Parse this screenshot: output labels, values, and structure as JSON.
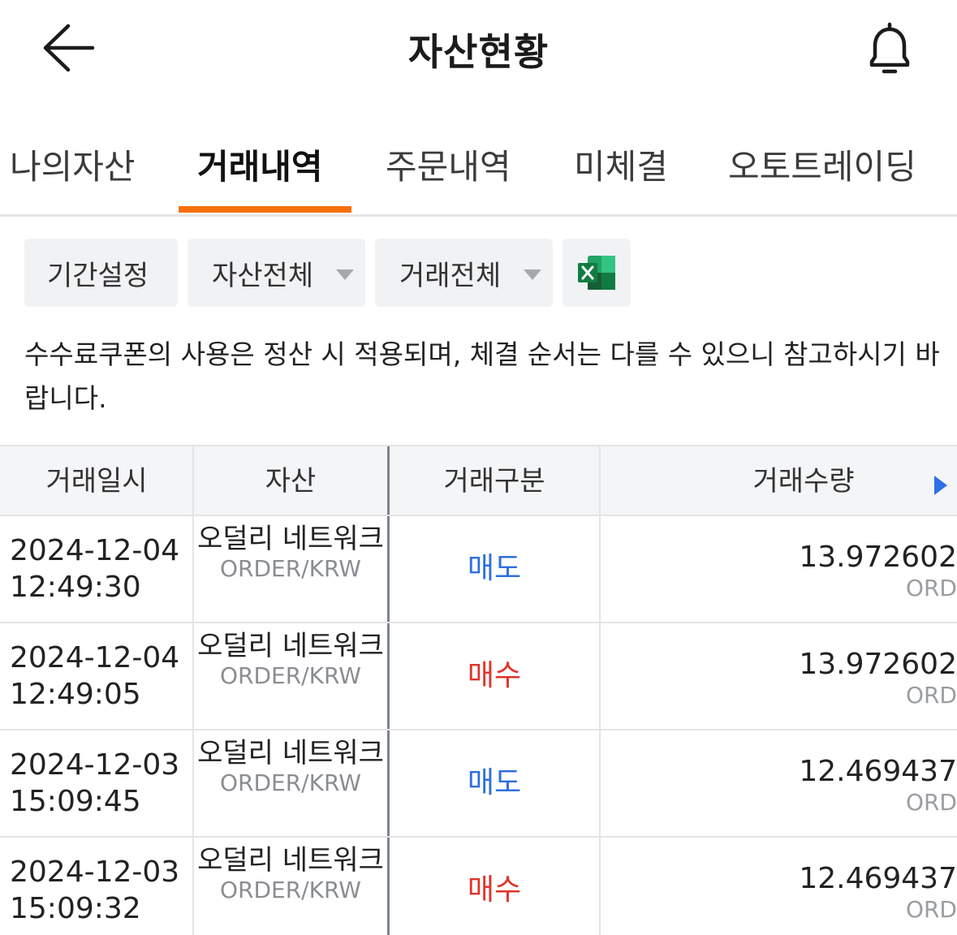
{
  "header": {
    "title": "자산현황",
    "back_icon": "arrow-left-icon",
    "bell_icon": "bell-icon"
  },
  "tabs": [
    {
      "label": "나의자산",
      "active": false
    },
    {
      "label": "거래내역",
      "active": true
    },
    {
      "label": "주문내역",
      "active": false
    },
    {
      "label": "미체결",
      "active": false
    },
    {
      "label": "오토트레이딩",
      "active": false
    }
  ],
  "colors": {
    "accent": "#f5700a",
    "sell": "#2e6fdf",
    "buy": "#e0342a",
    "excel": "#1e7145"
  },
  "filters": {
    "period": "기간설정",
    "asset": "자산전체",
    "trade": "거래전체",
    "excel_icon": "excel-icon"
  },
  "notice": "수수료쿠폰의 사용은 정산 시 적용되며, 체결 순서는 다를 수 있으니 참고하시기 바랍니다.",
  "table": {
    "headers": [
      "거래일시",
      "자산",
      "거래구분",
      "거래수량"
    ],
    "rows": [
      {
        "date": "2024-12-04",
        "time": "12:49:30",
        "asset": "오덜리 네트워크",
        "pair": "ORDER/KRW",
        "type": "매도",
        "side": "sell",
        "qty": "13.972602",
        "unit": "ORD"
      },
      {
        "date": "2024-12-04",
        "time": "12:49:05",
        "asset": "오덜리 네트워크",
        "pair": "ORDER/KRW",
        "type": "매수",
        "side": "buy",
        "qty": "13.972602",
        "unit": "ORD"
      },
      {
        "date": "2024-12-03",
        "time": "15:09:45",
        "asset": "오덜리 네트워크",
        "pair": "ORDER/KRW",
        "type": "매도",
        "side": "sell",
        "qty": "12.469437",
        "unit": "ORD"
      },
      {
        "date": "2024-12-03",
        "time": "15:09:32",
        "asset": "오덜리 네트워크",
        "pair": "ORDER/KRW",
        "type": "매수",
        "side": "buy",
        "qty": "12.469437",
        "unit": "ORD"
      }
    ]
  }
}
